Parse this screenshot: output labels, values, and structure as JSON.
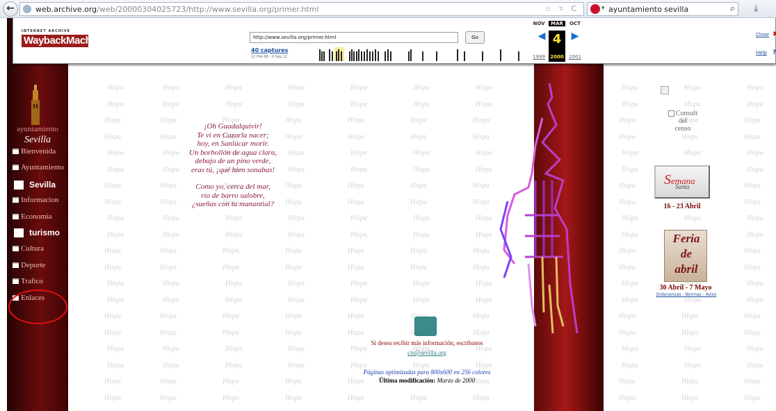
{
  "browser": {
    "back_label": "←",
    "url_host": "web.archive.org",
    "url_rest": "/web/20000304025723/http://www.sevilla.org/primer.html",
    "url_icons": "☆ ▿ C",
    "search_arrow": "▾",
    "search_text": "ayuntamiento sevilla",
    "search_icon": "⌕",
    "download_icon": "⤓"
  },
  "wayback": {
    "logo_small": "INTERNET ARCHIVE",
    "logo_big": "WaybackMachine",
    "url_value": "http://www.sevilla.org/primer.html",
    "go_label": "Go",
    "captures": "40 captures",
    "range": "12 Feb 98 - 9 Sep 12",
    "prev_month": "NOV",
    "cur_month": "MAR",
    "next_month": "OCT",
    "cur_day": "4",
    "prev_year": "1999",
    "cur_year": "2000",
    "next_year": "2001",
    "close_label": "Close",
    "close_x": "✖",
    "help_label": "Help",
    "help_q": "?"
  },
  "nav": {
    "logo_line1": "ayuntamiento",
    "logo_line2": "Sevilla",
    "items": [
      {
        "label": "Bienvenida"
      },
      {
        "label": "Ayuntamiento"
      },
      {
        "label": "Informacion"
      },
      {
        "label": "Economia"
      },
      {
        "label": "Cultura"
      },
      {
        "label": "Deporte"
      },
      {
        "label": "Trafico"
      },
      {
        "label": "Enlaces"
      }
    ],
    "headers": [
      "Sevilla",
      "turismo"
    ]
  },
  "poem": [
    "¡Oh Guadalquivir!",
    "Te vi en Cazorla nacer;",
    "hoy, en Sanlúcar morir.",
    "Un borbollón de agua clara,",
    "debajo de un pino verde,",
    "eras tú, ¡qué bien sonabas!",
    "Como yo, cerca del mar,",
    "río de barro salobre,",
    "¿sueñas con tu manantial?"
  ],
  "contact": {
    "text": "Si desea recibir más información, escribanos",
    "email": "cis@sevilla.org",
    "optimized": "Páginas optimizadas para 800x600 en 256 colores",
    "modified_label": "Última modificación:",
    "modified_value": "Marzo de 2000"
  },
  "right": {
    "censo_lines": [
      "Consult",
      "del",
      "censo"
    ],
    "semana_line1": "Semana",
    "semana_line2": "Santa",
    "semana_dates": "16 - 23 Abril",
    "feria_words": [
      "Feria",
      "de",
      "abril"
    ],
    "feria_dates": "30 Abril - 7 Mayo",
    "feria_links": "Ordenanzas - Normas - Aviso"
  },
  "watermark_text": "Hispa"
}
